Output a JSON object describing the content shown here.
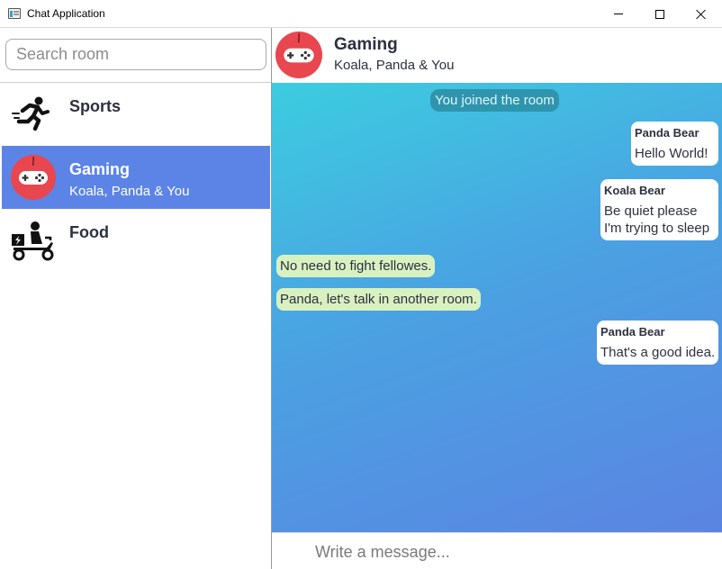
{
  "window": {
    "title": "Chat Application",
    "controls": [
      "minimize",
      "maximize",
      "close"
    ]
  },
  "search": {
    "placeholder": "Search room",
    "value": ""
  },
  "rooms": [
    {
      "name": "Sports",
      "subtitle": "",
      "icon": "running-man-icon",
      "selected": false
    },
    {
      "name": "Gaming",
      "subtitle": "Koala, Panda & You",
      "icon": "gamepad-avatar-icon",
      "selected": true
    },
    {
      "name": "Food",
      "subtitle": "",
      "icon": "delivery-scooter-icon",
      "selected": false
    }
  ],
  "chat": {
    "title": "Gaming",
    "members": "Koala, Panda & You",
    "icon": "gamepad-avatar-icon"
  },
  "messages": [
    {
      "type": "system",
      "text": "You joined the room"
    },
    {
      "type": "incoming",
      "sender": "Panda Bear",
      "lines": [
        "Hello World!"
      ]
    },
    {
      "type": "incoming",
      "sender": "Koala Bear",
      "lines": [
        "Be quiet please",
        "I'm trying to sleep"
      ]
    },
    {
      "type": "outgoing",
      "text": "No need to fight fellowes."
    },
    {
      "type": "outgoing",
      "text": "Panda, let's talk in another room."
    },
    {
      "type": "incoming",
      "sender": "Panda Bear",
      "lines": [
        "That's a good idea."
      ]
    }
  ],
  "composer": {
    "placeholder": "Write a message...",
    "value": ""
  },
  "colors": {
    "selected_room": "#5b84e6",
    "outgoing_bubble": "#d9f1c0",
    "incoming_bubble": "#ffffff",
    "system_bubble": "#2f95ad",
    "gradient_start": "#3ccde0",
    "gradient_end": "#5b84e2",
    "avatar_red": "#e8474f"
  }
}
